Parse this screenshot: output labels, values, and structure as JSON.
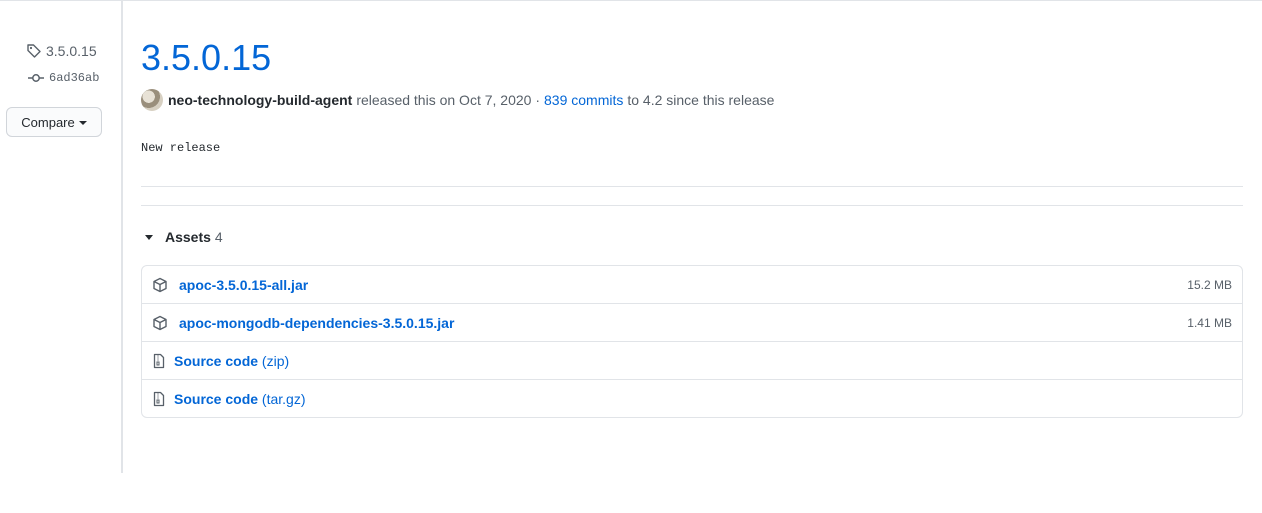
{
  "sidebar": {
    "tag": "3.5.0.15",
    "commit": "6ad36ab",
    "compare_label": "Compare"
  },
  "release": {
    "title": "3.5.0.15",
    "author": "neo-technology-build-agent",
    "released_text": "released this on Oct 7, 2020 ·",
    "commits_link": "839 commits",
    "commits_suffix": "to 4.2 since this release",
    "description": "New release"
  },
  "assets": {
    "label": "Assets",
    "count": "4",
    "items": [
      {
        "name": "apoc-3.5.0.15-all.jar",
        "size": "15.2 MB",
        "icon": "package-icon"
      },
      {
        "name": "apoc-mongodb-dependencies-3.5.0.15.jar",
        "size": "1.41 MB",
        "icon": "package-icon"
      },
      {
        "name": "Source code",
        "format": "(zip)",
        "icon": "file-zip-icon"
      },
      {
        "name": "Source code",
        "format": "(tar.gz)",
        "icon": "file-zip-icon"
      }
    ]
  },
  "colors": {
    "link": "#0366d6",
    "text": "#24292e",
    "muted": "#586069",
    "border": "#e1e4e8"
  }
}
